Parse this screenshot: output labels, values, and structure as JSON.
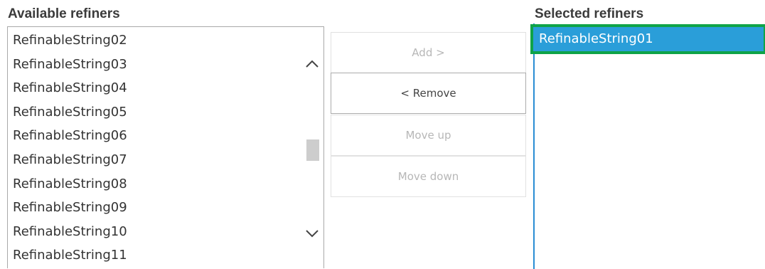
{
  "available": {
    "heading": "Available refiners",
    "items": [
      "RefinableString02",
      "RefinableString03",
      "RefinableString04",
      "RefinableString05",
      "RefinableString06",
      "RefinableString07",
      "RefinableString08",
      "RefinableString09",
      "RefinableString10",
      "RefinableString11"
    ],
    "scrollbar": {
      "up_icon": "chevron-up-icon",
      "down_icon": "chevron-down-icon"
    }
  },
  "buttons": {
    "add": {
      "label": "Add >",
      "enabled": false
    },
    "remove": {
      "label": "< Remove",
      "enabled": true
    },
    "move_up": {
      "label": "Move up",
      "enabled": false
    },
    "move_down": {
      "label": "Move down",
      "enabled": false
    }
  },
  "selected": {
    "heading": "Selected refiners",
    "items": [
      "RefinableString01"
    ],
    "selected_index": 0
  },
  "colors": {
    "selection_background": "#2a9ed9",
    "selection_highlight_border": "#0fa348",
    "selected_list_border": "#2a8dd4",
    "disabled_text": "#b7b7b7"
  }
}
